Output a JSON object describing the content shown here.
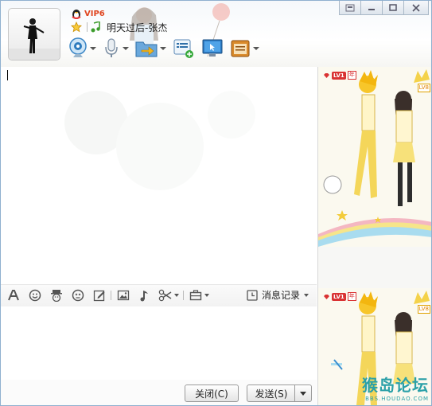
{
  "header": {
    "vip_label": "VIP6",
    "music_title": "明天过后-张杰"
  },
  "bottom": {
    "close_button": "关闭(C)",
    "send_button": "发送(S)"
  },
  "format_bar": {
    "history_label": "消息记录"
  },
  "right_panel": {
    "level_badge": "LV1",
    "year_badge": "年",
    "lv_right": "LV8",
    "watermark_main": "猴岛论坛",
    "watermark_sub": "BBS.HOUDAO.COM"
  }
}
